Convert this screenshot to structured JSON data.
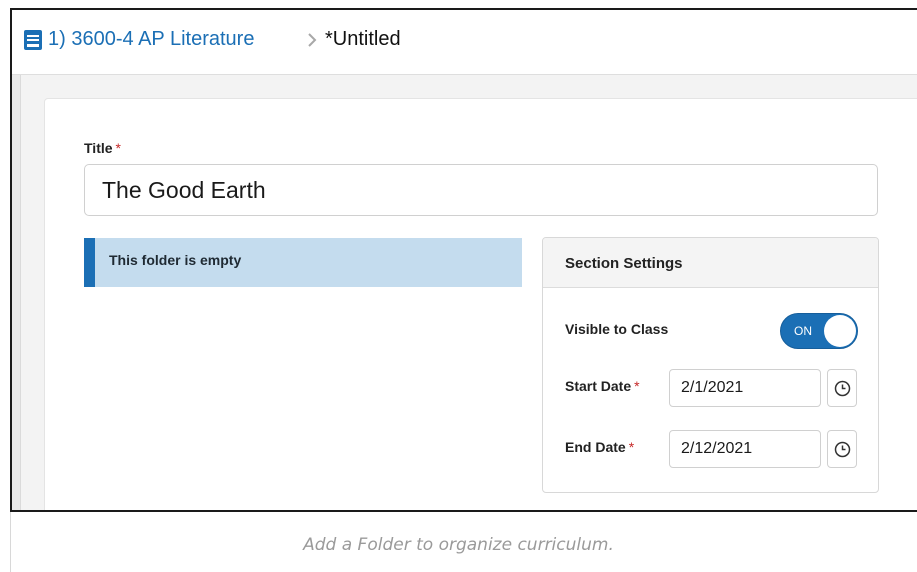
{
  "breadcrumb": {
    "icon": "book-icon",
    "parent": "1) 3600-4 AP Literature",
    "separator_icon": "chevron-right-icon",
    "current": "*Untitled"
  },
  "form": {
    "title_label": "Title",
    "required_mark": "*",
    "title_value": "The Good Earth",
    "empty_message": "This folder is empty"
  },
  "section_settings": {
    "heading": "Section Settings",
    "visible_label": "Visible to Class",
    "visible_toggle": "ON",
    "start_label": "Start Date",
    "start_value": "2/1/2021",
    "end_label": "End Date",
    "end_value": "2/12/2021",
    "picker_icon": "clock-icon"
  },
  "caption": "Add a Folder to organize curriculum.",
  "colors": {
    "accent": "#1b6fb5",
    "required": "#c62828",
    "banner_bg": "#c4dcee"
  }
}
